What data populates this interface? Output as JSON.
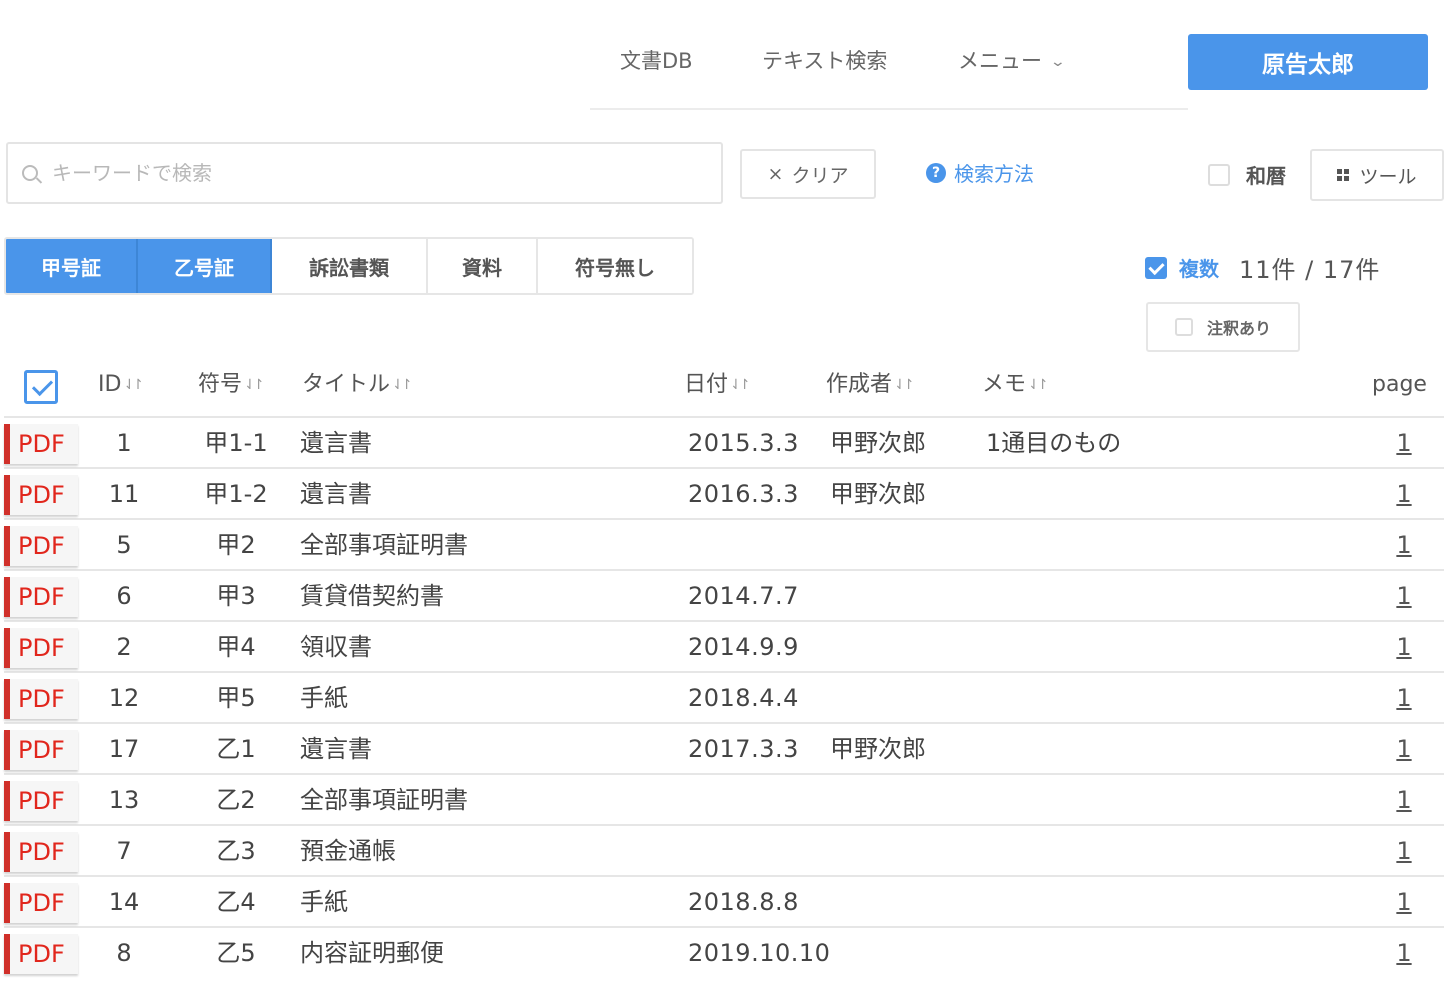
{
  "header": {
    "nav": {
      "doc_db": "文書DB",
      "text_search": "テキスト検索",
      "menu": "メニュー",
      "menu_chevron": "⌄"
    },
    "user_button": "原告太郎"
  },
  "search": {
    "placeholder": "キーワードで検索",
    "value": "",
    "clear_label": "クリア",
    "clear_icon": "×",
    "help_label": "検索方法",
    "help_icon": "?",
    "wareki_label": "和暦",
    "wareki_checked": false,
    "tool_label": "ツール"
  },
  "filters": {
    "tabs": [
      {
        "label": "甲号証",
        "active": true
      },
      {
        "label": "乙号証",
        "active": true
      },
      {
        "label": "訴訟書類",
        "active": false
      },
      {
        "label": "資料",
        "active": false
      },
      {
        "label": "符号無し",
        "active": false
      }
    ],
    "multi_label": "複数",
    "multi_checked": true,
    "count_text": "11件 / 17件",
    "annotation_label": "注釈あり",
    "annotation_checked": false
  },
  "table": {
    "headers": {
      "id": "ID",
      "symbol": "符号",
      "title": "タイトル",
      "date": "日付",
      "author": "作成者",
      "memo": "メモ",
      "page": "page",
      "sort_glyph": "⇃↾"
    },
    "select_all_checked": true,
    "pdf_label": "PDF",
    "rows": [
      {
        "id": "1",
        "symbol": "甲1-1",
        "title": "遺言書",
        "date": "2015.3.3",
        "author": "甲野次郎",
        "memo": "1通目のもの",
        "page": "1"
      },
      {
        "id": "11",
        "symbol": "甲1-2",
        "title": "遺言書",
        "date": "2016.3.3",
        "author": "甲野次郎",
        "memo": "",
        "page": "1"
      },
      {
        "id": "5",
        "symbol": "甲2",
        "title": "全部事項証明書",
        "date": "",
        "author": "",
        "memo": "",
        "page": "1"
      },
      {
        "id": "6",
        "symbol": "甲3",
        "title": "賃貸借契約書",
        "date": "2014.7.7",
        "author": "",
        "memo": "",
        "page": "1"
      },
      {
        "id": "2",
        "symbol": "甲4",
        "title": "領収書",
        "date": "2014.9.9",
        "author": "",
        "memo": "",
        "page": "1"
      },
      {
        "id": "12",
        "symbol": "甲5",
        "title": "手紙",
        "date": "2018.4.4",
        "author": "",
        "memo": "",
        "page": "1"
      },
      {
        "id": "17",
        "symbol": "乙1",
        "title": "遺言書",
        "date": "2017.3.3",
        "author": "甲野次郎",
        "memo": "",
        "page": "1"
      },
      {
        "id": "13",
        "symbol": "乙2",
        "title": "全部事項証明書",
        "date": "",
        "author": "",
        "memo": "",
        "page": "1"
      },
      {
        "id": "7",
        "symbol": "乙3",
        "title": "預金通帳",
        "date": "",
        "author": "",
        "memo": "",
        "page": "1"
      },
      {
        "id": "14",
        "symbol": "乙4",
        "title": "手紙",
        "date": "2018.8.8",
        "author": "",
        "memo": "",
        "page": "1"
      },
      {
        "id": "8",
        "symbol": "乙5",
        "title": "内容証明郵便",
        "date": "2019.10.10",
        "author": "",
        "memo": "",
        "page": "1"
      }
    ]
  },
  "colors": {
    "accent": "#4a95ea",
    "pdf_red": "#e1261c",
    "border": "#e6e6e6"
  }
}
